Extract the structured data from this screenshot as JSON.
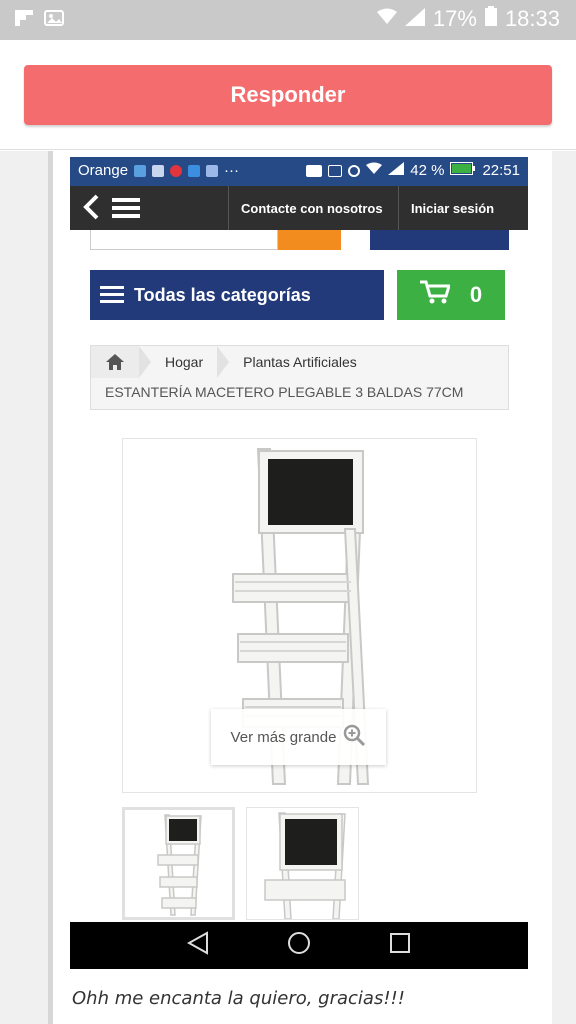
{
  "status_bar": {
    "battery": "17%",
    "time": "18:33",
    "icons": [
      "flipboard-icon",
      "image-icon",
      "wifi-icon",
      "signal-icon",
      "battery-icon"
    ]
  },
  "reply": {
    "label": "Responder"
  },
  "shot": {
    "status": {
      "carrier": "Orange",
      "battery": "42 %",
      "time": "22:51"
    },
    "nav": {
      "contact": "Contacte con nosotros",
      "login": "Iniciar sesión"
    },
    "categories_label": "Todas las categorías",
    "cart_count": "0",
    "breadcrumb": {
      "items": [
        "Hogar",
        "Plantas Artificiales"
      ],
      "current": "ESTANTERÍA MACETERO PLEGABLE 3 BALDAS 77CM"
    },
    "zoom_label": "Ver más grande",
    "colors": {
      "status_blue": "#254a86",
      "nav_dark": "#2f2f2f",
      "category_blue": "#233a7a",
      "cart_green": "#3cb043",
      "search_orange": "#f28c1f"
    }
  },
  "comment": {
    "text": "Ohh me encanta la quiero, gracias!!!"
  },
  "colors": {
    "reply_button": "#f46c6e",
    "status_bar": "#c9c9c9"
  }
}
